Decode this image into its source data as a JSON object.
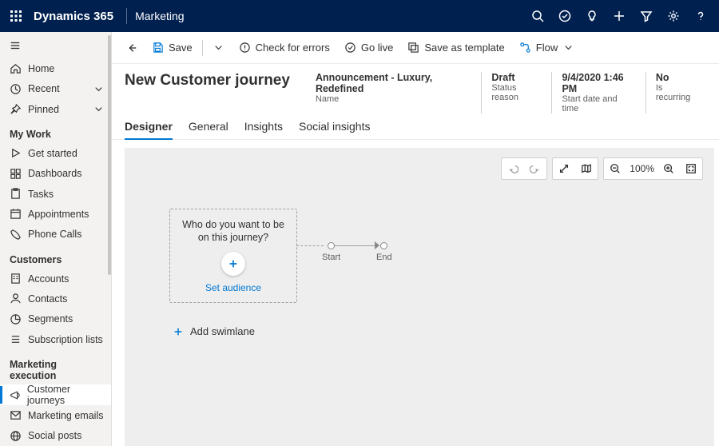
{
  "topbar": {
    "brand": "Dynamics 365",
    "app": "Marketing"
  },
  "cmd": {
    "save": "Save",
    "check": "Check for errors",
    "golive": "Go live",
    "template": "Save as template",
    "flow": "Flow"
  },
  "header": {
    "title": "New Customer journey",
    "name_value": "Announcement - Luxury, Redefined",
    "name_label": "Name",
    "status_value": "Draft",
    "status_label": "Status reason",
    "date_value": "9/4/2020 1:46 PM",
    "date_label": "Start date and time",
    "recurring_value": "No",
    "recurring_label": "Is recurring"
  },
  "tabs": {
    "designer": "Designer",
    "general": "General",
    "insights": "Insights",
    "social": "Social insights"
  },
  "sidebar": {
    "home": "Home",
    "recent": "Recent",
    "pinned": "Pinned",
    "mywork": "My Work",
    "getstarted": "Get started",
    "dashboards": "Dashboards",
    "tasks": "Tasks",
    "appointments": "Appointments",
    "phonecalls": "Phone Calls",
    "customers": "Customers",
    "accounts": "Accounts",
    "contacts": "Contacts",
    "segments": "Segments",
    "sublists": "Subscription lists",
    "exec": "Marketing execution",
    "journeys": "Customer journeys",
    "emails": "Marketing emails",
    "social_posts": "Social posts"
  },
  "canvas": {
    "question": "Who do you want to be on this journey?",
    "set_audience": "Set audience",
    "start": "Start",
    "end": "End",
    "add_swimlane": "Add swimlane",
    "zoom": "100%"
  }
}
